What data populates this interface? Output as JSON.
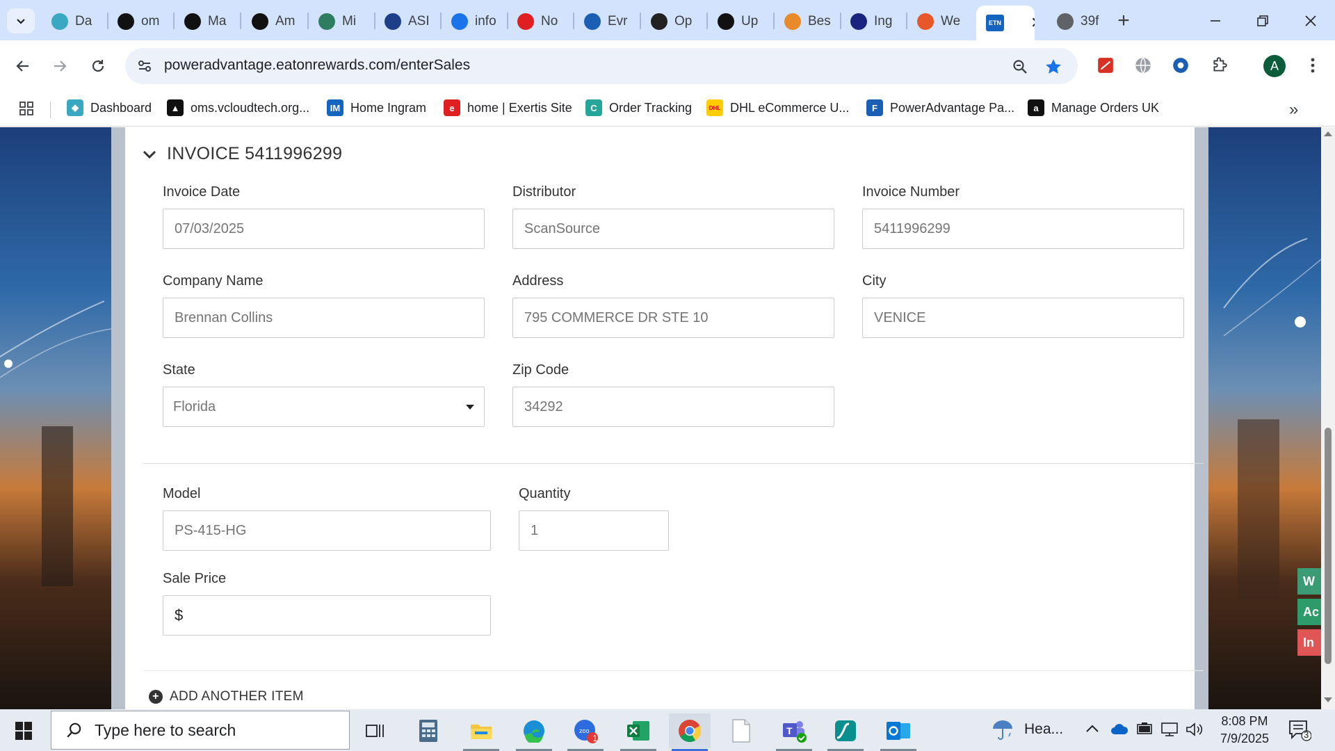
{
  "tabs": [
    {
      "label": "Da",
      "icon": "dashboard-icon",
      "color": "#3aa8c1"
    },
    {
      "label": "om",
      "icon": "oms-icon",
      "color": "#111111"
    },
    {
      "label": "Ma",
      "icon": "amazon-icon",
      "color": "#111111"
    },
    {
      "label": "Am",
      "icon": "amazon-icon",
      "color": "#111111"
    },
    {
      "label": "Mi",
      "icon": "leaf-icon",
      "color": "#2e7d60"
    },
    {
      "label": "ASI",
      "icon": "play-icon",
      "color": "#1d3f8a"
    },
    {
      "label": "info",
      "icon": "flag-icon",
      "color": "#1a73e8"
    },
    {
      "label": "No",
      "icon": "exertis-icon",
      "color": "#e02020"
    },
    {
      "label": "Evr",
      "icon": "evr-icon",
      "color": "#1a5fb4"
    },
    {
      "label": "Op",
      "icon": "openai-icon",
      "color": "#222222"
    },
    {
      "label": "Up",
      "icon": "openai-icon",
      "color": "#111111"
    },
    {
      "label": "Bes",
      "icon": "bulb-icon",
      "color": "#e88a2a"
    },
    {
      "label": "Ing",
      "icon": "ingram-icon",
      "color": "#1a237e"
    },
    {
      "label": "We",
      "icon": "stack-icon",
      "color": "#e8572a"
    },
    {
      "label": "ETN",
      "icon": "etn-icon",
      "color": "#1565c0"
    },
    {
      "label": "39f",
      "icon": "globe-icon",
      "color": "#5f6368"
    }
  ],
  "url": "poweradvantage.eatonrewards.com/enterSales",
  "bookmarks": [
    {
      "label": "Dashboard",
      "color": "#3aa8c1"
    },
    {
      "label": "oms.vcloudtech.org...",
      "color": "#111111"
    },
    {
      "label": "Home Ingram",
      "color": "#1565c0"
    },
    {
      "label": "home | Exertis Site",
      "color": "#e02020"
    },
    {
      "label": "Order Tracking",
      "color": "#26a69a"
    },
    {
      "label": "DHL eCommerce U...",
      "color": "#ffcc00"
    },
    {
      "label": "PowerAdvantage Pa...",
      "color": "#1a5fb4"
    },
    {
      "label": "Manage Orders UK",
      "color": "#111111"
    }
  ],
  "avatar_letter": "A",
  "invoice": {
    "heading": "INVOICE 5411996299",
    "date_label": "Invoice Date",
    "date_value": "07/03/2025",
    "distributor_label": "Distributor",
    "distributor_value": "ScanSource",
    "number_label": "Invoice Number",
    "number_value": "5411996299",
    "company_label": "Company Name",
    "company_value": "Brennan Collins",
    "address_label": "Address",
    "address_value": "795 COMMERCE DR STE 10",
    "city_label": "City",
    "city_value": "VENICE",
    "state_label": "State",
    "state_value": "Florida",
    "zip_label": "Zip Code",
    "zip_value": "34292"
  },
  "item": {
    "model_label": "Model",
    "model_value": "PS-415-HG",
    "quantity_label": "Quantity",
    "quantity_value": "1",
    "price_label": "Sale Price",
    "currency": "$"
  },
  "add_item_label": "ADD ANOTHER ITEM",
  "side_widgets": [
    {
      "label": "W",
      "color": "#3a9b74"
    },
    {
      "label": "Ac",
      "color": "#2e9b6a"
    },
    {
      "label": "In",
      "color": "#e05555"
    }
  ],
  "taskbar": {
    "search_placeholder": "Type here to search",
    "weather_label": "Hea...",
    "time": "8:08 PM",
    "date": "7/9/2025",
    "notification_count": "3",
    "zoom_badge": "1"
  }
}
